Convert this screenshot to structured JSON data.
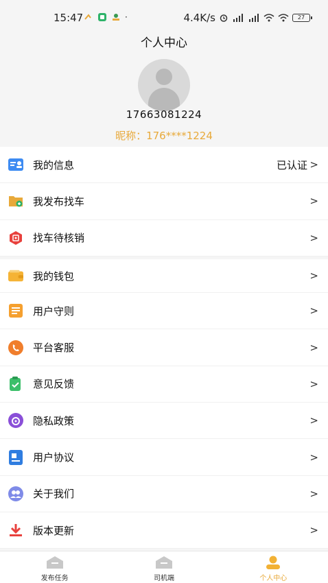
{
  "status_bar": {
    "time": "15:47",
    "speed": "4.4K/s",
    "battery": "27"
  },
  "header": {
    "title": "个人中心",
    "phone": "17663081224",
    "nickname": "昵称：176****1224"
  },
  "menu": {
    "items": [
      {
        "label": "我的信息",
        "value": "已认证",
        "icon": "id-card-icon"
      },
      {
        "label": "我发布找车",
        "value": "",
        "icon": "folder-icon"
      },
      {
        "label": "找车待核销",
        "value": "",
        "icon": "scan-icon"
      },
      {
        "label": "我的钱包",
        "value": "",
        "icon": "wallet-icon"
      },
      {
        "label": "用户守则",
        "value": "",
        "icon": "document-icon"
      },
      {
        "label": "平台客服",
        "value": "",
        "icon": "phone-icon"
      },
      {
        "label": "意见反馈",
        "value": "",
        "icon": "feedback-icon"
      },
      {
        "label": "隐私政策",
        "value": "",
        "icon": "privacy-icon"
      },
      {
        "label": "用户协议",
        "value": "",
        "icon": "agreement-icon"
      },
      {
        "label": "关于我们",
        "value": "",
        "icon": "group-icon"
      },
      {
        "label": "版本更新",
        "value": "",
        "icon": "download-icon"
      }
    ],
    "chevron": ">"
  },
  "tabbar": {
    "tabs": [
      {
        "label": "发布任务",
        "active": false
      },
      {
        "label": "司机端",
        "active": false
      },
      {
        "label": "个人中心",
        "active": true
      }
    ]
  },
  "colors": {
    "accent": "#e8a93a",
    "background": "#f5f5f5"
  }
}
